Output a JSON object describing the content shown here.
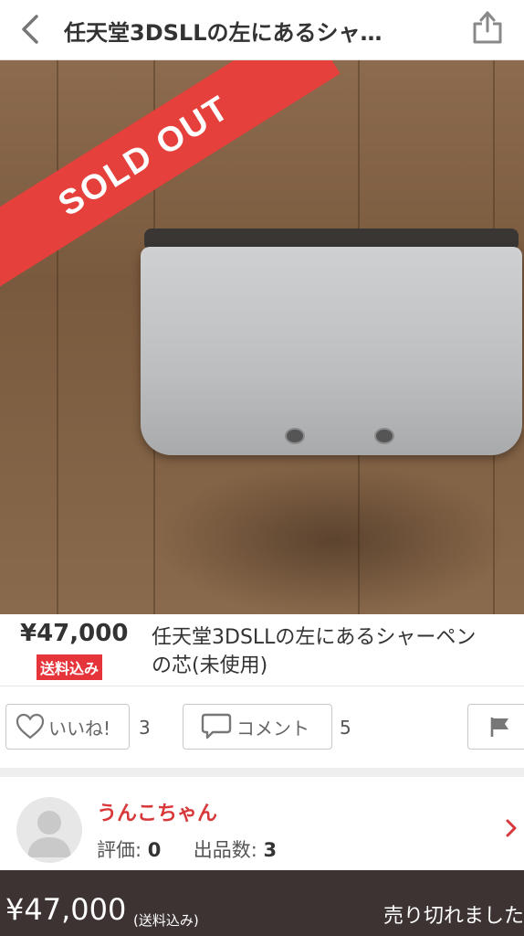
{
  "header": {
    "title": "任天堂3DSLLの左にあるシャ…",
    "back_icon": "chevron-left-icon",
    "share_icon": "share-icon"
  },
  "photo": {
    "sold_out_label": "SOLD OUT"
  },
  "item": {
    "price": "¥47,000",
    "shipping_badge": "送料込み",
    "name_line1": "任天堂3DSLLの左にあるシャーペン",
    "name_line2": "の芯(未使用)"
  },
  "actions": {
    "like_label": "いいね!",
    "like_count": "3",
    "comment_label": "コメント",
    "comment_count": "5",
    "flag_icon": "flag-icon"
  },
  "seller": {
    "name": "うんこちゃん",
    "rating_label": "評価:",
    "rating_value": "0",
    "listings_label": "出品数:",
    "listings_value": "3"
  },
  "bottom": {
    "price": "¥47,000",
    "shipping": "(送料込み)",
    "status": "売り切れました"
  },
  "colors": {
    "accent_red": "#e5403b",
    "bottom_bar": "#3d3333"
  }
}
